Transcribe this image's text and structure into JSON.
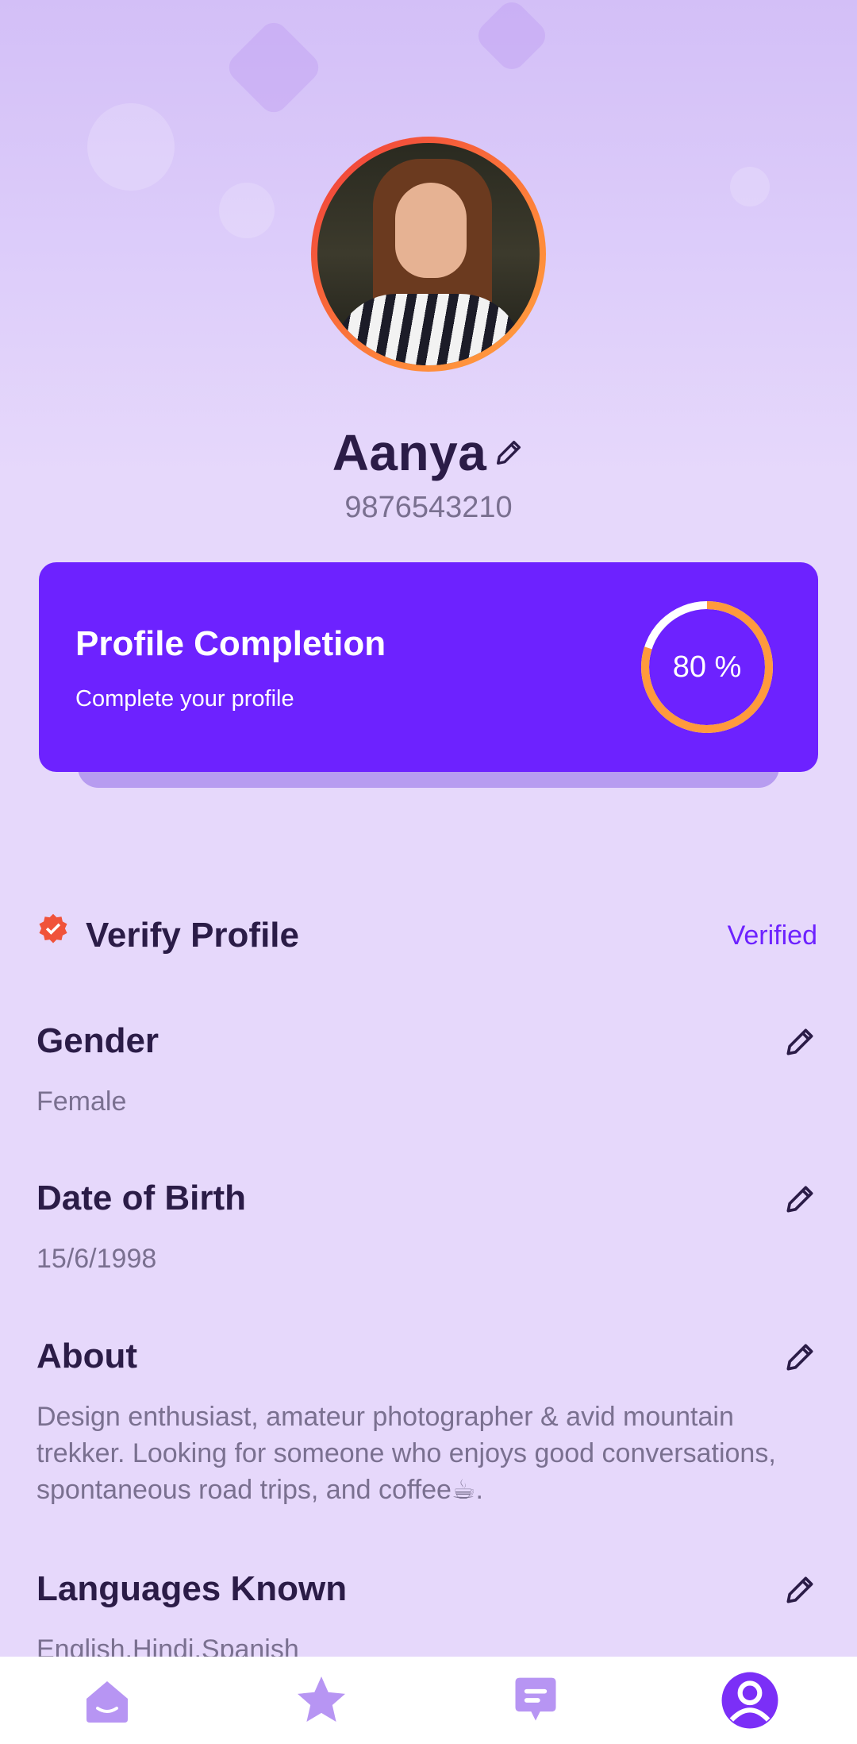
{
  "profile": {
    "name": "Aanya",
    "phone": "9876543210"
  },
  "completion": {
    "title": "Profile Completion",
    "subtitle": "Complete your profile",
    "percent": 80,
    "percent_label": "80 %",
    "ring_color": "#ff9a3c",
    "card_color": "#6d22ff"
  },
  "verify": {
    "title": "Verify Profile",
    "status": "Verified",
    "badge_color": "#f0533a"
  },
  "fields": [
    {
      "title": "Gender",
      "value": "Female"
    },
    {
      "title": "Date of Birth",
      "value": "15/6/1998"
    },
    {
      "title": "About",
      "value": "Design enthusiast, amateur photographer & avid mountain trekker. Looking for someone who enjoys good conversations, spontaneous road trips, and coffee☕."
    },
    {
      "title": "Languages Known",
      "value": "English,Hindi,Spanish"
    }
  ],
  "tabs": [
    {
      "icon": "home-icon",
      "active": false
    },
    {
      "icon": "star-icon",
      "active": false
    },
    {
      "icon": "chat-icon",
      "active": false
    },
    {
      "icon": "profile-icon",
      "active": true
    }
  ],
  "colors": {
    "accent": "#6d22ff",
    "tab_icon": "#b795f3",
    "tab_icon_active": "#7b2ff7"
  }
}
